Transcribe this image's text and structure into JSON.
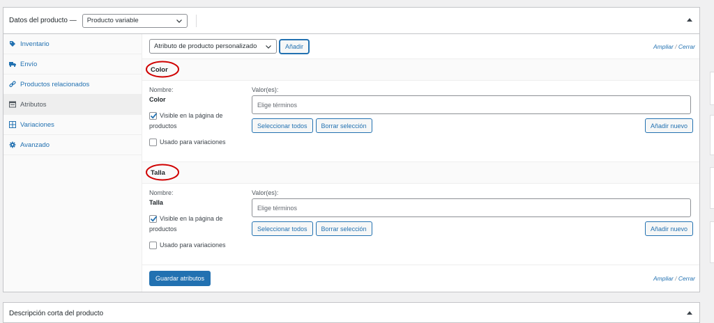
{
  "header": {
    "title": "Datos del producto —",
    "product_type": "Producto variable"
  },
  "sidebar": {
    "items": [
      {
        "label": "Inventario",
        "icon": "tag-icon"
      },
      {
        "label": "Envío",
        "icon": "truck-icon"
      },
      {
        "label": "Productos relacionados",
        "icon": "link-icon"
      },
      {
        "label": "Atributos",
        "icon": "list-icon"
      },
      {
        "label": "Variaciones",
        "icon": "grid-icon"
      },
      {
        "label": "Avanzado",
        "icon": "gear-icon"
      }
    ],
    "active": "Atributos"
  },
  "toolbar": {
    "attribute_select": "Atributo de producto personalizado",
    "add_label": "Añadir",
    "expand": "Ampliar",
    "separator": "/",
    "close": "Cerrar"
  },
  "attributes": [
    {
      "title": "Color",
      "name_label": "Nombre:",
      "name_value": "Color",
      "values_label": "Valor(es):",
      "placeholder": "Elige términos",
      "visible_label_line1": "Visible en la página de",
      "visible_label_line2": "productos",
      "visible_checked": true,
      "variations_label": "Usado para variaciones",
      "variations_checked": false,
      "select_all": "Seleccionar todos",
      "clear": "Borrar selección",
      "add_new": "Añadir nuevo"
    },
    {
      "title": "Talla",
      "name_label": "Nombre:",
      "name_value": "Talla",
      "values_label": "Valor(es):",
      "placeholder": "Elige términos",
      "visible_label_line1": "Visible en la página de",
      "visible_label_line2": "productos",
      "visible_checked": true,
      "variations_label": "Usado para variaciones",
      "variations_checked": false,
      "select_all": "Seleccionar todos",
      "clear": "Borrar selección",
      "add_new": "Añadir nuevo"
    }
  ],
  "footer": {
    "save_label": "Guardar atributos",
    "expand": "Ampliar",
    "separator": "/",
    "close": "Cerrar"
  },
  "short_description": {
    "title": "Descripción corta del producto"
  },
  "colors": {
    "accent": "#2271b1",
    "annotation_circle": "#d00000"
  }
}
